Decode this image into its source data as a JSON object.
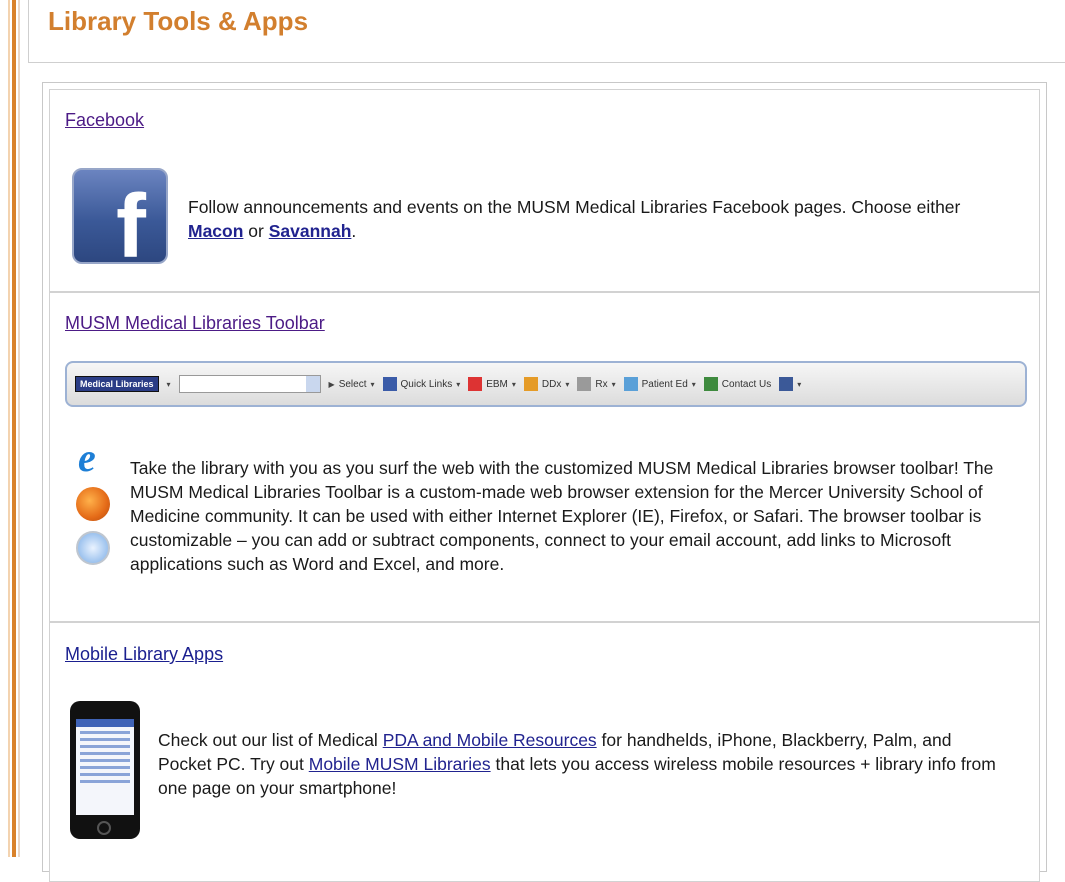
{
  "page": {
    "title": "Library Tools & Apps"
  },
  "sections": [
    {
      "link": "Facebook",
      "text_before": "Follow announcements and events on the MUSM Medical Libraries Facebook pages. Choose either ",
      "link_a": "Macon",
      "text_mid": " or ",
      "link_b": "Savannah",
      "text_after": "."
    },
    {
      "link": "MUSM Medical Libraries Toolbar",
      "toolbar": {
        "logo": "Medical Libraries",
        "items": [
          "Select",
          "Quick Links",
          "EBM",
          "DDx",
          "Rx",
          "Patient Ed",
          "Contact Us"
        ]
      },
      "text": "Take the library with you as you surf the web with the customized MUSM Medical Libraries browser toolbar! The MUSM Medical Libraries Toolbar is a custom-made web browser extension for the Mercer University School of Medicine community. It can be used with either Internet Explorer (IE), Firefox, or Safari. The browser toolbar is customizable – you can add or subtract components, connect to your email account, add links to Microsoft applications such as Word and Excel, and more."
    },
    {
      "link": "Mobile Library Apps",
      "text_before": "Check out our list of Medical ",
      "link_a": "PDA and Mobile Resources",
      "text_mid": " for handhelds, iPhone, Blackberry, Palm, and Pocket PC. Try out ",
      "link_b": "Mobile MUSM Libraries",
      "text_after": " that lets you access wireless mobile resources + library info from one page on your smartphone!"
    }
  ],
  "icons": {
    "facebook": "facebook-logo-icon",
    "ie": "internet-explorer-icon",
    "firefox": "firefox-icon",
    "safari": "safari-icon",
    "phone": "iphone-icon"
  },
  "colors": {
    "accent": "#d27f2e",
    "link": "#21238f",
    "visited": "#4c1b86"
  }
}
